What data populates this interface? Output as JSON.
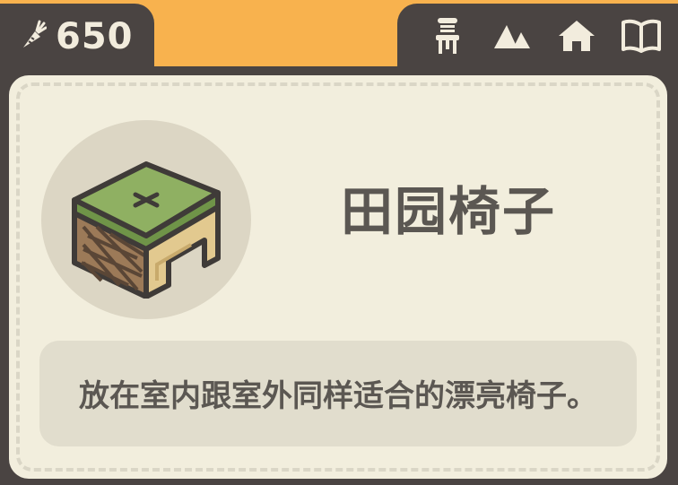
{
  "currency": {
    "icon": "carrot-icon",
    "amount": "650"
  },
  "nav": [
    {
      "icon": "chair-icon",
      "label": "Furniture"
    },
    {
      "icon": "mountain-icon",
      "label": "Outdoor"
    },
    {
      "icon": "home-icon",
      "label": "Home"
    },
    {
      "icon": "book-icon",
      "label": "Album"
    }
  ],
  "item": {
    "name": "田园椅子",
    "description": "放在室内跟室外同样适合的漂亮椅子。",
    "icon": "rustic-chair-icon"
  },
  "colors": {
    "frame": "#4a4442",
    "panel": "#f2eedd",
    "accent": "#f8b24e",
    "text": "#5b5752"
  }
}
